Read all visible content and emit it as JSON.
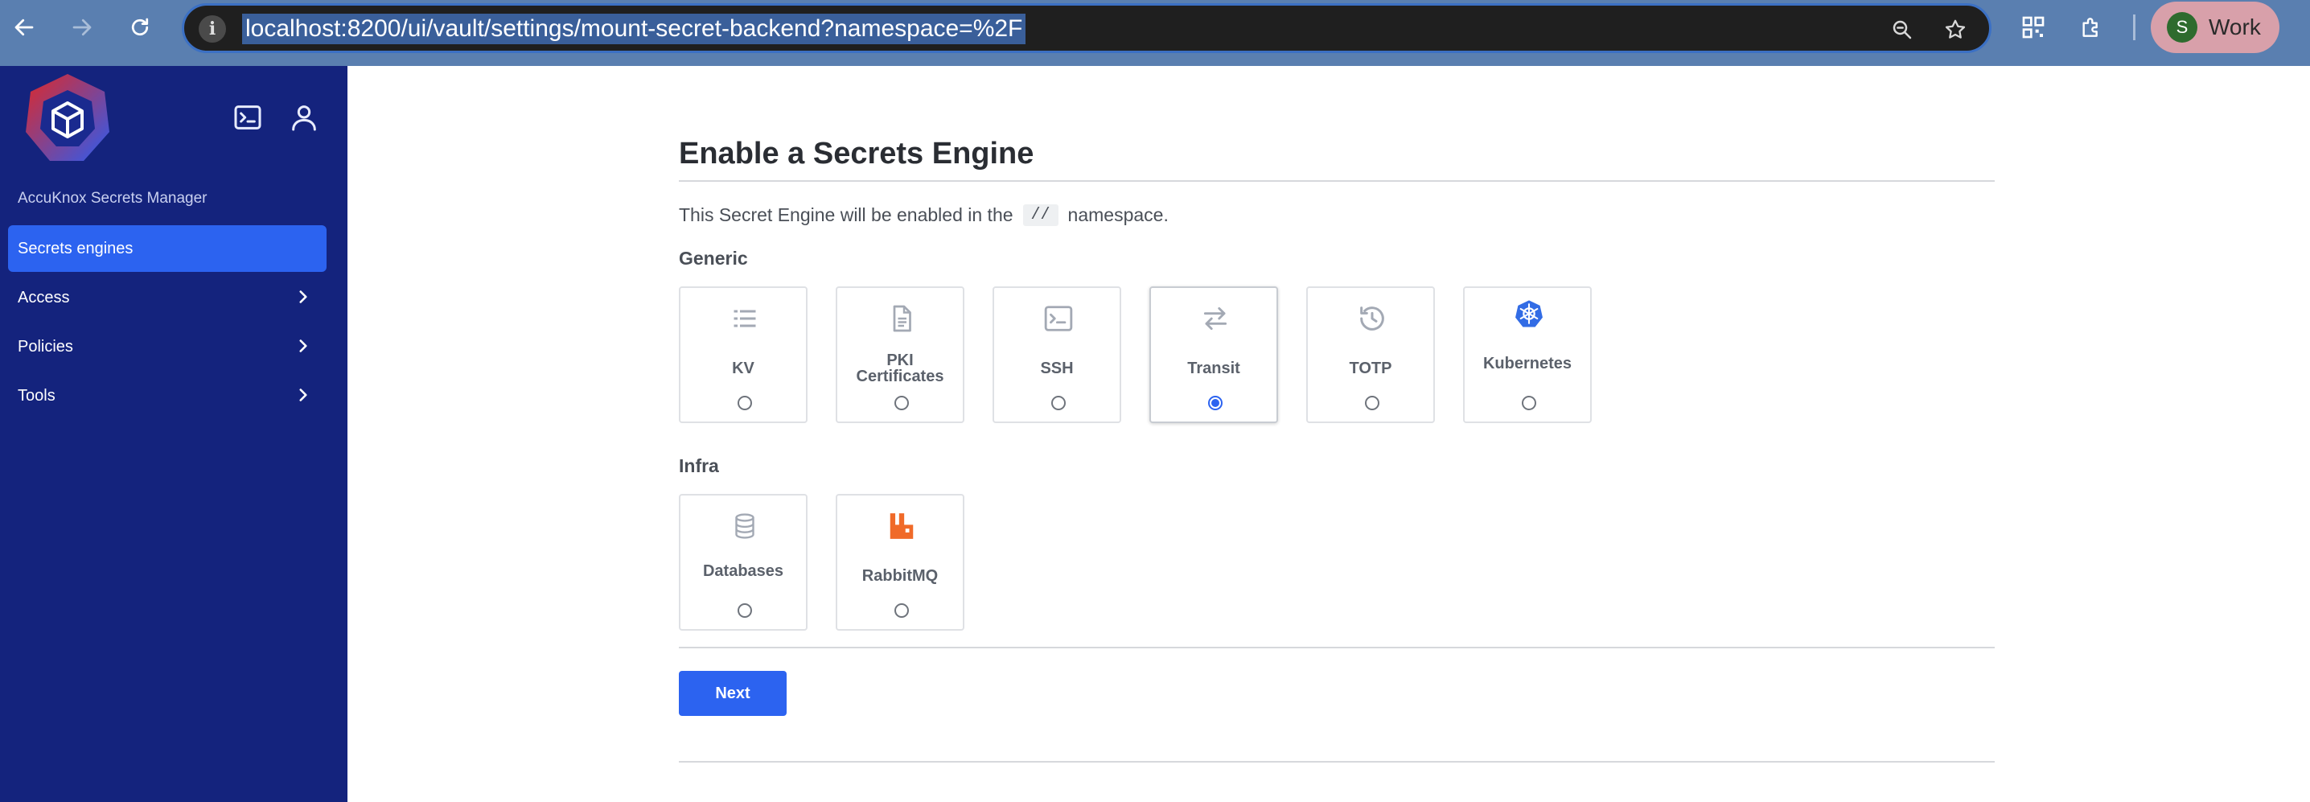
{
  "browser": {
    "url": "localhost:8200/ui/vault/settings/mount-secret-backend?namespace=%2F",
    "profile_initial": "S",
    "profile_name": "Work"
  },
  "sidebar": {
    "brand": "AccuKnox Secrets Manager",
    "items": [
      {
        "label": "Secrets engines",
        "active": true
      },
      {
        "label": "Access"
      },
      {
        "label": "Policies"
      },
      {
        "label": "Tools"
      }
    ]
  },
  "page": {
    "title": "Enable a Secrets Engine",
    "intro_before": "This Secret Engine will be enabled in the",
    "namespace": "//",
    "intro_after": "namespace.",
    "next_label": "Next"
  },
  "groups": {
    "generic": {
      "label": "Generic",
      "engines": [
        {
          "label": "KV",
          "icon": "list-icon"
        },
        {
          "label": "PKI Certificates",
          "icon": "document-icon"
        },
        {
          "label": "SSH",
          "icon": "terminal-icon"
        },
        {
          "label": "Transit",
          "icon": "swap-arrows-icon",
          "selected": true
        },
        {
          "label": "TOTP",
          "icon": "history-icon"
        },
        {
          "label": "Kubernetes",
          "icon": "kubernetes-icon"
        }
      ]
    },
    "infra": {
      "label": "Infra",
      "engines": [
        {
          "label": "Databases",
          "icon": "database-icon"
        },
        {
          "label": "RabbitMQ",
          "icon": "rabbitmq-icon"
        }
      ]
    }
  },
  "colors": {
    "sidebar_bg": "#14237d",
    "accent": "#2c63f0",
    "chrome_bg": "#5a7fb0",
    "kubernetes": "#326ce5",
    "rabbitmq": "#f06a29"
  }
}
